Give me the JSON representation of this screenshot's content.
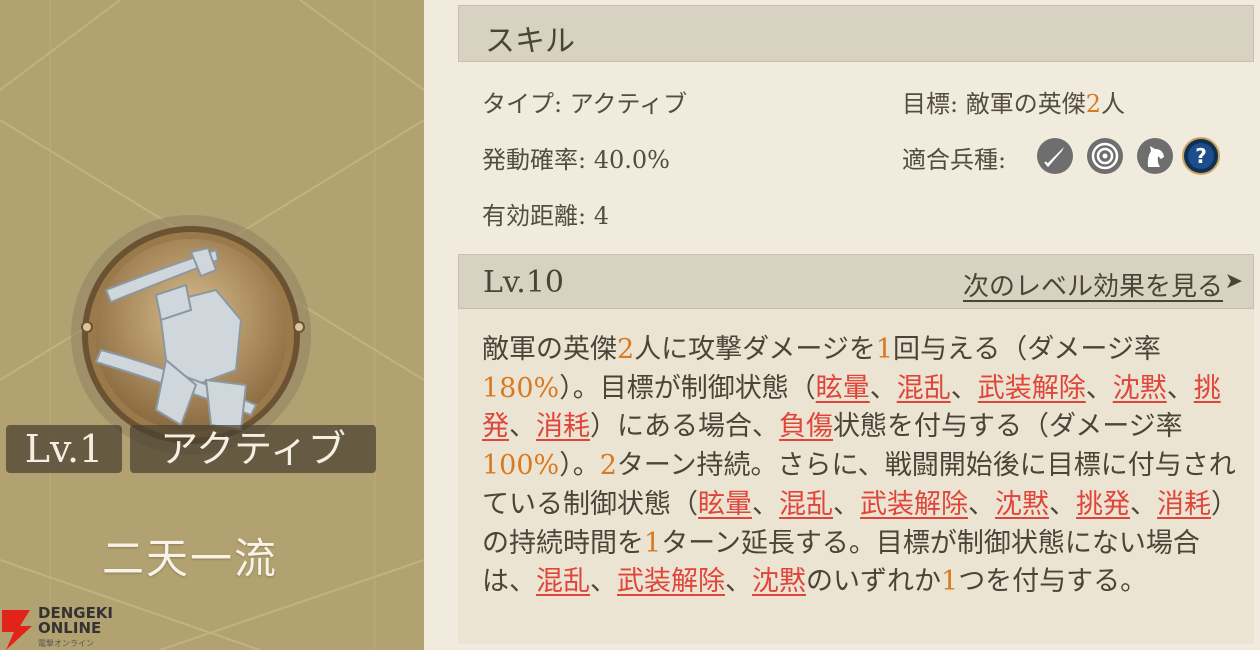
{
  "card": {
    "level": "Lv.1",
    "type": "アクティブ",
    "skill_name": "二天一流",
    "emblem": "dual-sword-samurai-emblem"
  },
  "watermark": {
    "line1": "DENGEKI",
    "line2": "ONLINE",
    "line3": "電撃オンライン"
  },
  "skill": {
    "title": "スキル",
    "type_label": "タイプ:",
    "type_value": "アクティブ",
    "rate_label": "発動確率:",
    "rate_value": "40.0%",
    "range_label": "有効距離:",
    "range_value": "4",
    "target_label": "目標:",
    "target_prefix": "敵軍の英傑",
    "target_count": "2",
    "target_suffix": "人",
    "troops_label": "適合兵種:",
    "troop_icons": [
      "sword-troop-icon",
      "archer-target-icon",
      "cavalry-horse-icon",
      "unknown-troop-icon"
    ]
  },
  "level": {
    "label": "Lv.10",
    "next_link": "次のレベル効果を見る",
    "arrow": "➤"
  },
  "description": {
    "segments": [
      {
        "t": "敵軍の英傑",
        "s": "n"
      },
      {
        "t": "2",
        "s": "num"
      },
      {
        "t": "人に攻撃ダメージを",
        "s": "n"
      },
      {
        "t": "1",
        "s": "num"
      },
      {
        "t": "回与える（ダメージ率",
        "s": "n"
      },
      {
        "t": "180%",
        "s": "num"
      },
      {
        "t": "）。目標が制御状態（",
        "s": "n"
      },
      {
        "t": "眩暈",
        "s": "kw"
      },
      {
        "t": "、",
        "s": "n"
      },
      {
        "t": "混乱",
        "s": "kw"
      },
      {
        "t": "、",
        "s": "n"
      },
      {
        "t": "武装解除",
        "s": "kw"
      },
      {
        "t": "、",
        "s": "n"
      },
      {
        "t": "沈黙",
        "s": "kw"
      },
      {
        "t": "、",
        "s": "n"
      },
      {
        "t": "挑発",
        "s": "kw"
      },
      {
        "t": "、",
        "s": "n"
      },
      {
        "t": "消耗",
        "s": "kw"
      },
      {
        "t": "）にある場合、",
        "s": "n"
      },
      {
        "t": "負傷",
        "s": "kw"
      },
      {
        "t": "状態を付与する（ダメージ率",
        "s": "n"
      },
      {
        "t": "100%",
        "s": "num"
      },
      {
        "t": "）。",
        "s": "n"
      },
      {
        "t": "2",
        "s": "num"
      },
      {
        "t": "ターン持続。さらに、戦闘開始後に目標に付与されている制御状態（",
        "s": "n"
      },
      {
        "t": "眩暈",
        "s": "kw"
      },
      {
        "t": "、",
        "s": "n"
      },
      {
        "t": "混乱",
        "s": "kw"
      },
      {
        "t": "、",
        "s": "n"
      },
      {
        "t": "武装解除",
        "s": "kw"
      },
      {
        "t": "、",
        "s": "n"
      },
      {
        "t": "沈黙",
        "s": "kw"
      },
      {
        "t": "、",
        "s": "n"
      },
      {
        "t": "挑発",
        "s": "kw"
      },
      {
        "t": "、",
        "s": "n"
      },
      {
        "t": "消耗",
        "s": "kw"
      },
      {
        "t": "）の持続時間を",
        "s": "n"
      },
      {
        "t": "1",
        "s": "num"
      },
      {
        "t": "ターン延長する。目標が制御状態にない場合は、",
        "s": "n"
      },
      {
        "t": "混乱",
        "s": "kw"
      },
      {
        "t": "、",
        "s": "n"
      },
      {
        "t": "武装解除",
        "s": "kw"
      },
      {
        "t": "、",
        "s": "n"
      },
      {
        "t": "沈黙",
        "s": "kw"
      },
      {
        "t": "のいずれか",
        "s": "n"
      },
      {
        "t": "1",
        "s": "num"
      },
      {
        "t": "つを付与する。",
        "s": "n"
      }
    ]
  },
  "colors": {
    "card_bg": "#b3a271",
    "panel_bg": "#f1ebdd",
    "header_bar": "#d8d2c3",
    "number_orange": "#d87a22",
    "keyword_red": "#e0453a"
  }
}
